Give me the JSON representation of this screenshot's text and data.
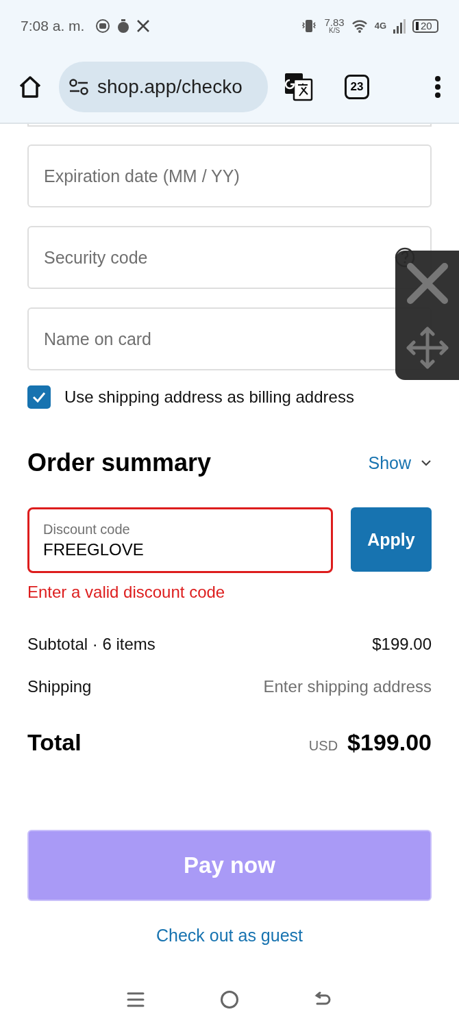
{
  "status_bar": {
    "time": "7:08 a. m.",
    "net_speed": "7.83",
    "net_unit": "K/S",
    "network": "4G",
    "battery": "20"
  },
  "browser": {
    "url": "shop.app/checko",
    "tab_count": "23"
  },
  "payment_fields": [
    {
      "placeholder": "Expiration date (MM / YY)",
      "kind": "plain"
    },
    {
      "placeholder": "Security code",
      "kind": "help"
    },
    {
      "placeholder": "Name on card",
      "kind": "plain"
    }
  ],
  "billing_checkbox": {
    "label": "Use shipping address as billing address",
    "checked": true
  },
  "order_summary": {
    "title": "Order summary",
    "toggle": "Show",
    "expanded": false
  },
  "discount": {
    "label": "Discount code",
    "value": "FREEGLOVE",
    "invalid": true,
    "error": "Enter a valid discount code",
    "button": "Apply"
  },
  "summary_rows": [
    {
      "label": "Subtotal · 6 items",
      "value": "$199.00",
      "kind": "amount"
    },
    {
      "label": "Shipping",
      "value": "Enter shipping address",
      "kind": "muted"
    }
  ],
  "total": {
    "label": "Total",
    "currency": "USD",
    "amount": "$199.00"
  },
  "pay_button": {
    "label": "Pay now",
    "disabled": true
  },
  "guest_link": "Check out as guest"
}
